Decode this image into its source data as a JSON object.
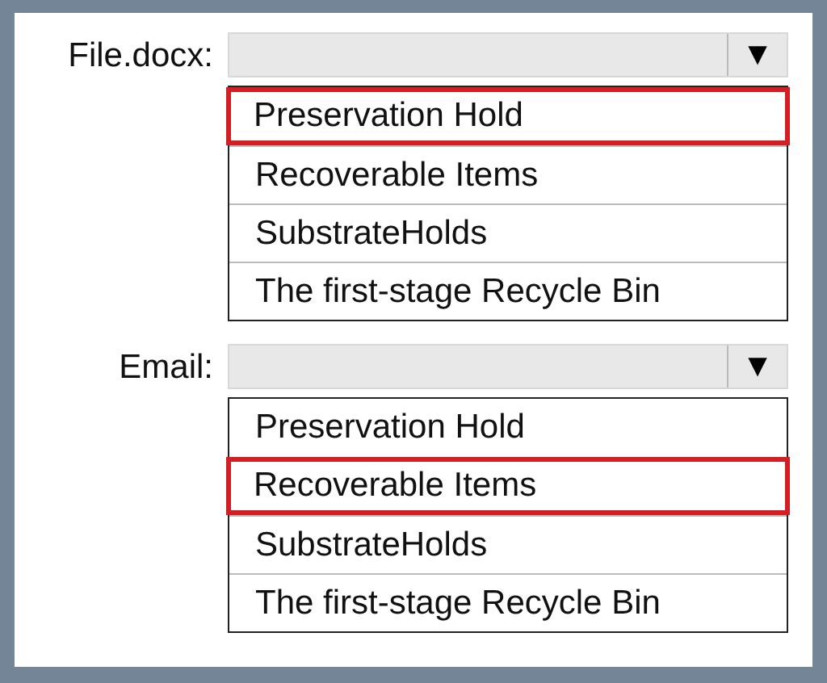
{
  "dropdowns": [
    {
      "label": "File.docx:",
      "arrow": "▼",
      "options": [
        {
          "text": "Preservation Hold",
          "selected": true
        },
        {
          "text": "Recoverable Items",
          "selected": false
        },
        {
          "text": "SubstrateHolds",
          "selected": false
        },
        {
          "text": "The first-stage Recycle Bin",
          "selected": false
        }
      ]
    },
    {
      "label": "Email:",
      "arrow": "▼",
      "options": [
        {
          "text": "Preservation Hold",
          "selected": false
        },
        {
          "text": "Recoverable Items",
          "selected": true
        },
        {
          "text": "SubstrateHolds",
          "selected": false
        },
        {
          "text": "The first-stage Recycle Bin",
          "selected": false
        }
      ]
    }
  ]
}
